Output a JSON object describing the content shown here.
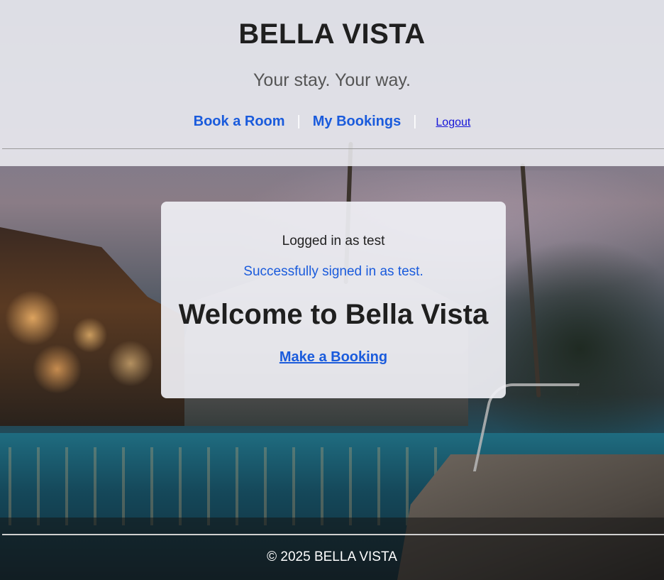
{
  "header": {
    "title": "BELLA VISTA",
    "tagline": "Your stay. Your way.",
    "nav": {
      "book_room": "Book a Room",
      "separator": "|",
      "my_bookings": "My Bookings",
      "logout": "Logout"
    }
  },
  "card": {
    "logged_in_text": "Logged in as test",
    "flash_message": "Successfully signed in as test.",
    "welcome_heading": "Welcome to Bella Vista",
    "cta_label": "Make a Booking"
  },
  "footer": {
    "copyright": "© 2025 BELLA VISTA"
  },
  "colors": {
    "link_blue": "#1a5bdc",
    "logout_blue": "#1515d8",
    "heading_dark": "#1f1f1f"
  },
  "background": {
    "icon": "resort-pool-night-photo"
  }
}
